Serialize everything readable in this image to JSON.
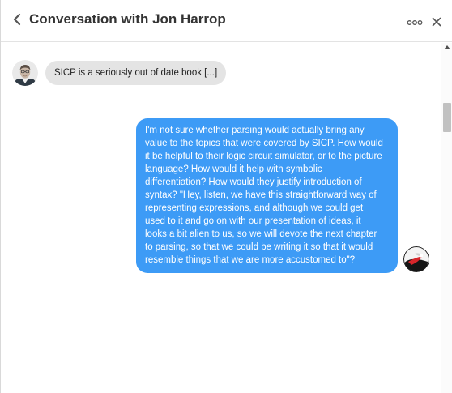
{
  "header": {
    "title": "Conversation with Jon Harrop",
    "back_icon": "chevron-left-icon",
    "more_icon": "three-dots-icon",
    "close_icon": "close-icon"
  },
  "messages": [
    {
      "direction": "incoming",
      "avatar": "jon-harrop-avatar",
      "text": "SICP is a seriously out of date book [...]"
    },
    {
      "direction": "outgoing",
      "avatar": "user-avatar",
      "lines": [
        "I'm not sure whether parsing would actually bring any",
        "value to the topics that were covered by SICP. How would",
        "it be helpful to their logic circuit simulator, or to the picture",
        "language? How would it help with symbolic",
        "differentiation? How would they justify introduction of",
        "syntax? \"Hey, listen, we have this straightforward way of",
        "representing expressions, and although we could get",
        "used to it and go on with our presentation of ideas, it",
        "looks a bit alien to us, so we will devote the next chapter",
        "to parsing, so that we could be writing it so that it would",
        "resemble things that we are more accustomed to\"?"
      ]
    }
  ],
  "colors": {
    "outgoing_bubble": "#3d9bf6",
    "incoming_bubble": "#e4e4e4"
  }
}
